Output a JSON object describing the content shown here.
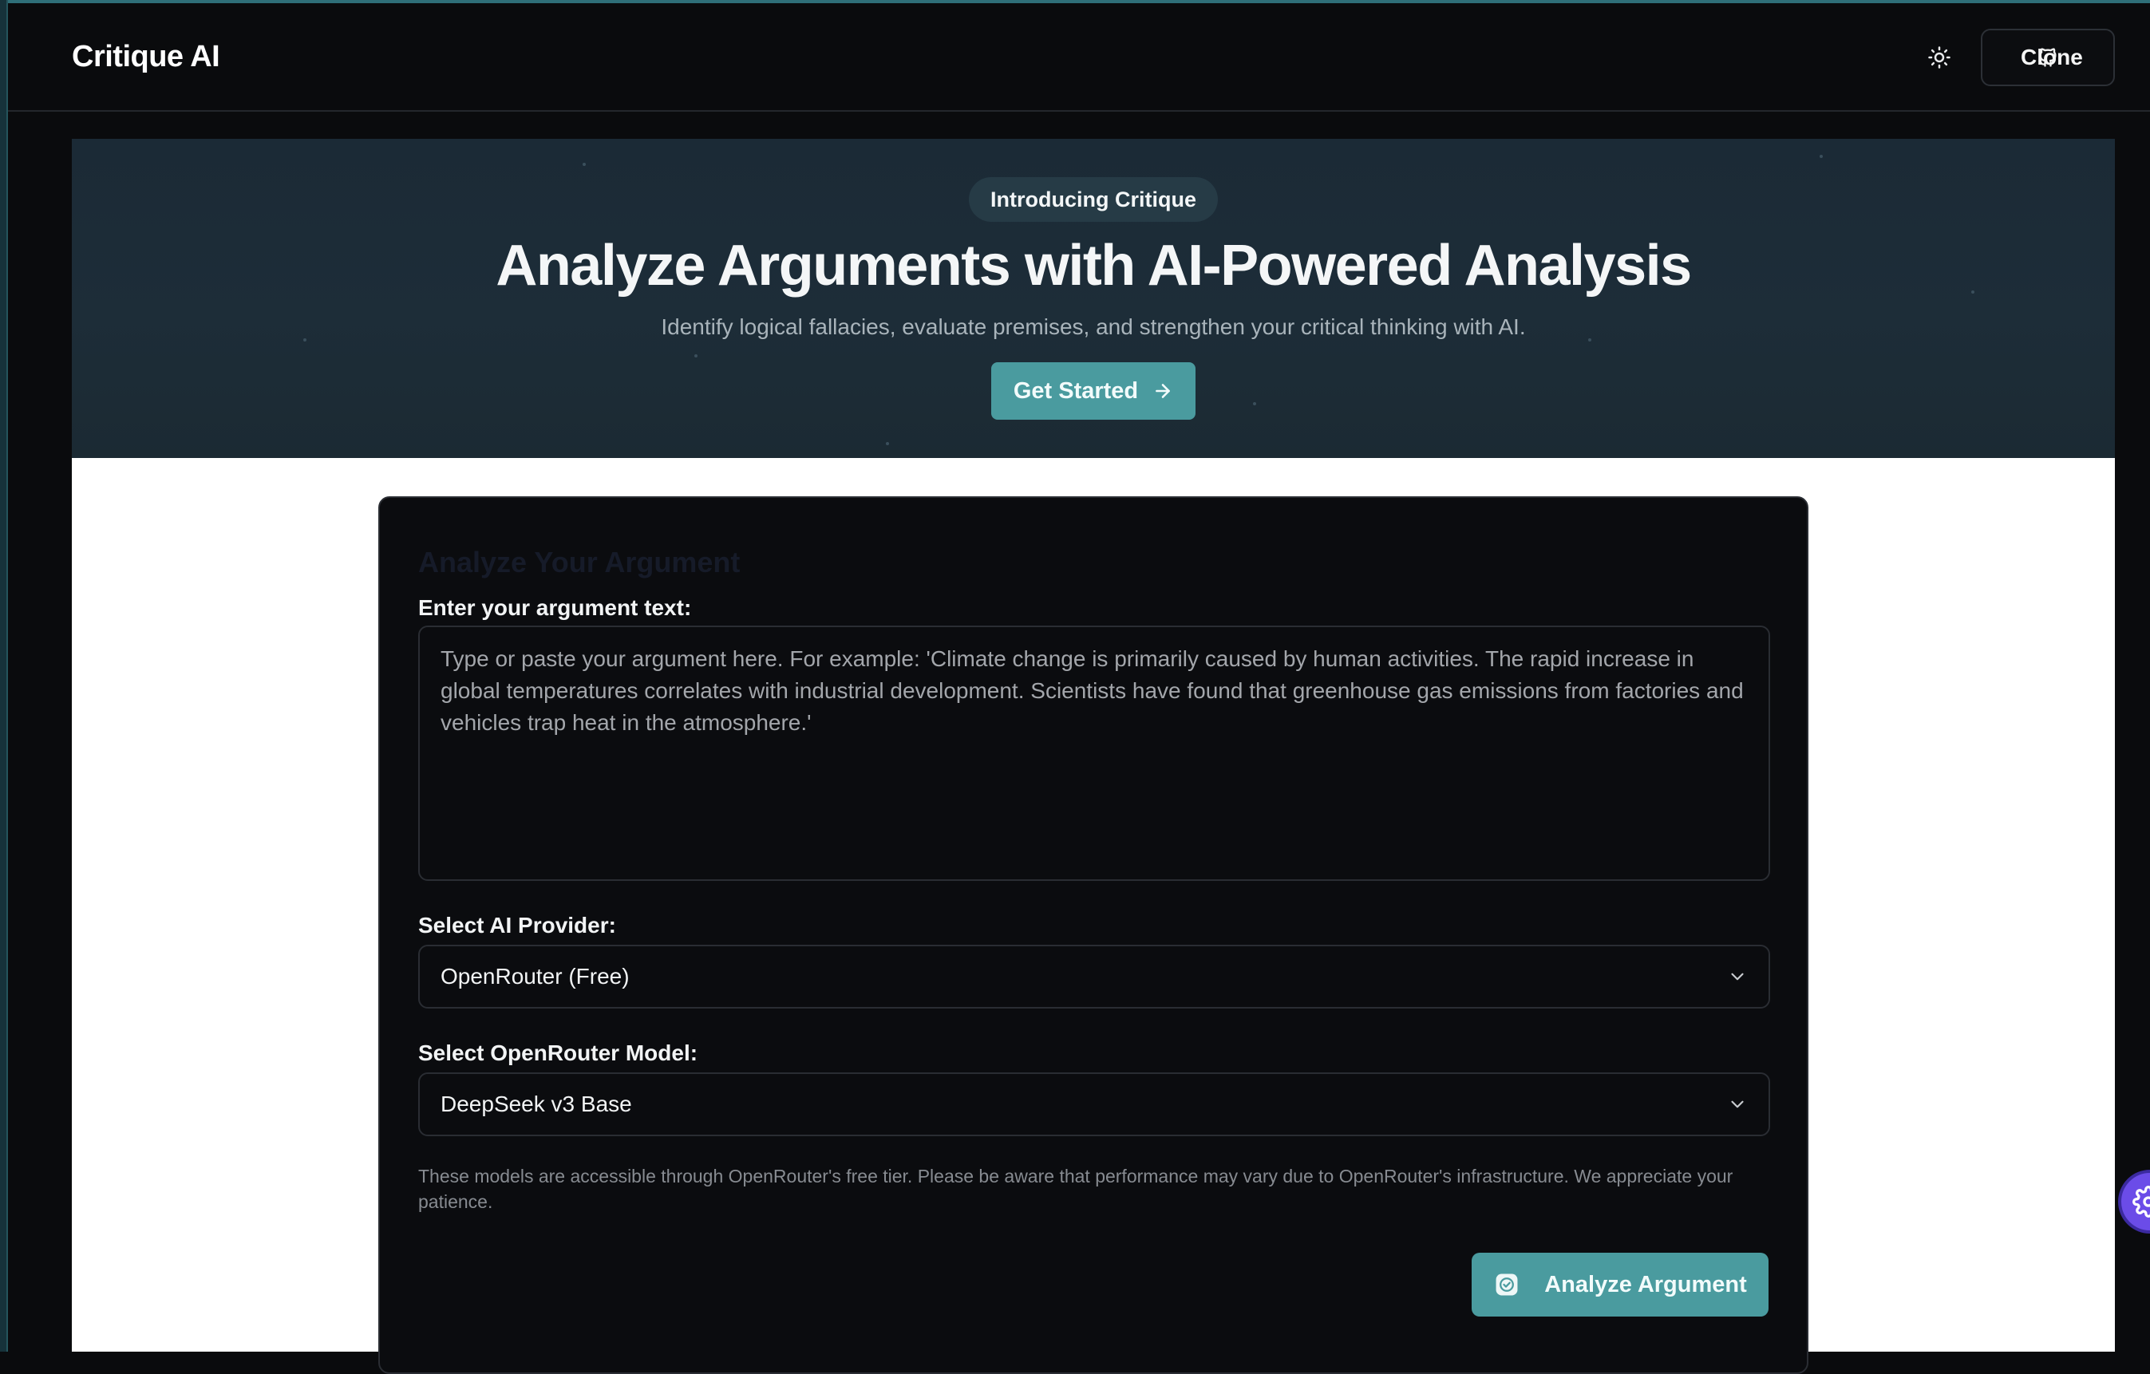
{
  "navbar": {
    "brand": "Critique AI",
    "theme_toggle_icon": "sun-icon",
    "clone_label": "Clone",
    "clone_icon": "github-icon"
  },
  "hero": {
    "badge": "Introducing Critique",
    "title": "Analyze Arguments with AI-Powered Analysis",
    "subtitle": "Identify logical fallacies, evaluate premises, and strengthen your critical thinking with AI.",
    "cta_label": "Get Started",
    "cta_icon": "arrow-right-icon"
  },
  "form": {
    "title": "Analyze Your Argument",
    "argument_label": "Enter your argument text:",
    "argument_value": "",
    "argument_placeholder": "Type or paste your argument here. For example: 'Climate change is primarily caused by human activities. The rapid increase in global temperatures correlates with industrial development. Scientists have found that greenhouse gas emissions from factories and vehicles trap heat in the atmosphere.'",
    "provider_label": "Select AI Provider:",
    "provider_value": "OpenRouter (Free)",
    "model_label": "Select OpenRouter Model:",
    "model_value": "DeepSeek v3 Base",
    "model_note": "These models are accessible through OpenRouter's free tier. Please be aware that performance may vary due to OpenRouter's infrastructure. We appreciate your patience.",
    "submit_label": "Analyze Argument",
    "submit_icon": "check-badge-icon"
  },
  "floating_button_icon": "gear-icon",
  "colors": {
    "accent": "#4a9b9f",
    "background": "#0a0b0d",
    "hero_bg": "#1b2a36",
    "fab": "#6b4ce8"
  }
}
